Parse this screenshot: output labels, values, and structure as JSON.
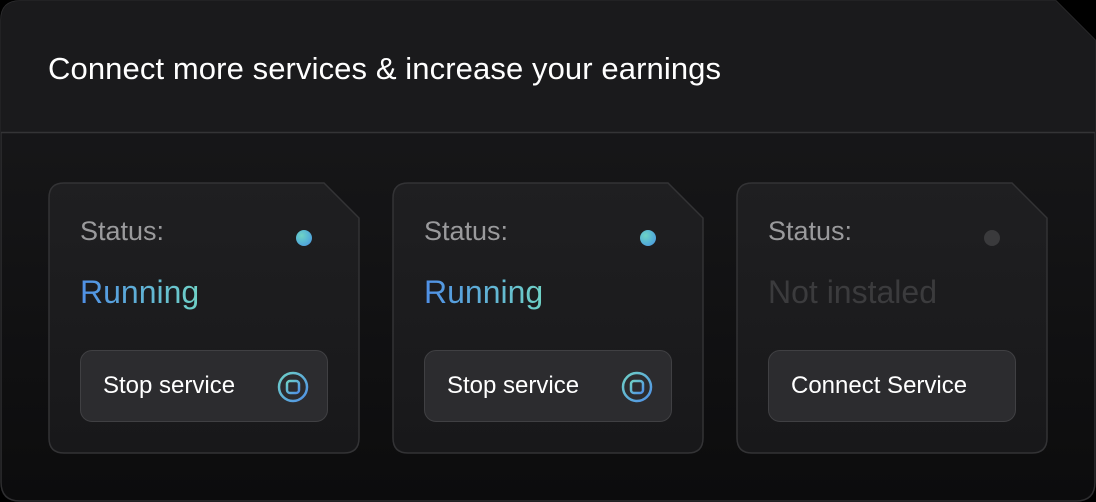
{
  "panel": {
    "title": "Connect more services & increase your earnings"
  },
  "colors": {
    "background": "#000000",
    "panel_header": "#1c1c1e",
    "card": "#1c1c1e",
    "button": "#2c2c2f",
    "accent_start": "#4f8fe6",
    "accent_end": "#6fd1c6",
    "inactive": "#3b3b3d"
  },
  "services": [
    {
      "status_label": "Status:",
      "status_value": "Running",
      "state": "running",
      "button_label": "Stop service",
      "button_icon": "stop-icon"
    },
    {
      "status_label": "Status:",
      "status_value": "Running",
      "state": "running",
      "button_label": "Stop service",
      "button_icon": "stop-icon"
    },
    {
      "status_label": "Status:",
      "status_value": "Not instaled",
      "state": "not-installed",
      "button_label": "Connect Service",
      "button_icon": ""
    }
  ]
}
